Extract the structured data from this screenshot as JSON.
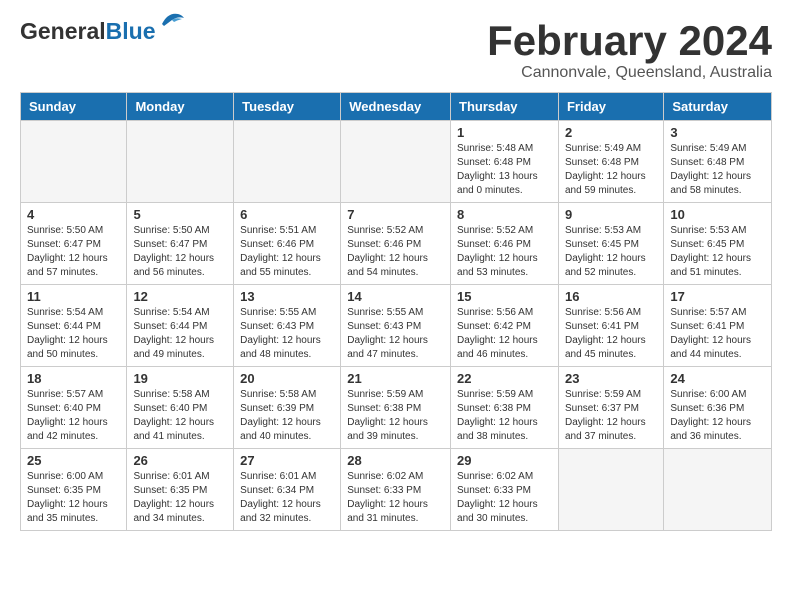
{
  "header": {
    "logo_general": "General",
    "logo_blue": "Blue",
    "title": "February 2024",
    "location": "Cannonvale, Queensland, Australia"
  },
  "days_of_week": [
    "Sunday",
    "Monday",
    "Tuesday",
    "Wednesday",
    "Thursday",
    "Friday",
    "Saturday"
  ],
  "weeks": [
    [
      {
        "day": "",
        "info": ""
      },
      {
        "day": "",
        "info": ""
      },
      {
        "day": "",
        "info": ""
      },
      {
        "day": "",
        "info": ""
      },
      {
        "day": "1",
        "info": "Sunrise: 5:48 AM\nSunset: 6:48 PM\nDaylight: 13 hours\nand 0 minutes."
      },
      {
        "day": "2",
        "info": "Sunrise: 5:49 AM\nSunset: 6:48 PM\nDaylight: 12 hours\nand 59 minutes."
      },
      {
        "day": "3",
        "info": "Sunrise: 5:49 AM\nSunset: 6:48 PM\nDaylight: 12 hours\nand 58 minutes."
      }
    ],
    [
      {
        "day": "4",
        "info": "Sunrise: 5:50 AM\nSunset: 6:47 PM\nDaylight: 12 hours\nand 57 minutes."
      },
      {
        "day": "5",
        "info": "Sunrise: 5:50 AM\nSunset: 6:47 PM\nDaylight: 12 hours\nand 56 minutes."
      },
      {
        "day": "6",
        "info": "Sunrise: 5:51 AM\nSunset: 6:46 PM\nDaylight: 12 hours\nand 55 minutes."
      },
      {
        "day": "7",
        "info": "Sunrise: 5:52 AM\nSunset: 6:46 PM\nDaylight: 12 hours\nand 54 minutes."
      },
      {
        "day": "8",
        "info": "Sunrise: 5:52 AM\nSunset: 6:46 PM\nDaylight: 12 hours\nand 53 minutes."
      },
      {
        "day": "9",
        "info": "Sunrise: 5:53 AM\nSunset: 6:45 PM\nDaylight: 12 hours\nand 52 minutes."
      },
      {
        "day": "10",
        "info": "Sunrise: 5:53 AM\nSunset: 6:45 PM\nDaylight: 12 hours\nand 51 minutes."
      }
    ],
    [
      {
        "day": "11",
        "info": "Sunrise: 5:54 AM\nSunset: 6:44 PM\nDaylight: 12 hours\nand 50 minutes."
      },
      {
        "day": "12",
        "info": "Sunrise: 5:54 AM\nSunset: 6:44 PM\nDaylight: 12 hours\nand 49 minutes."
      },
      {
        "day": "13",
        "info": "Sunrise: 5:55 AM\nSunset: 6:43 PM\nDaylight: 12 hours\nand 48 minutes."
      },
      {
        "day": "14",
        "info": "Sunrise: 5:55 AM\nSunset: 6:43 PM\nDaylight: 12 hours\nand 47 minutes."
      },
      {
        "day": "15",
        "info": "Sunrise: 5:56 AM\nSunset: 6:42 PM\nDaylight: 12 hours\nand 46 minutes."
      },
      {
        "day": "16",
        "info": "Sunrise: 5:56 AM\nSunset: 6:41 PM\nDaylight: 12 hours\nand 45 minutes."
      },
      {
        "day": "17",
        "info": "Sunrise: 5:57 AM\nSunset: 6:41 PM\nDaylight: 12 hours\nand 44 minutes."
      }
    ],
    [
      {
        "day": "18",
        "info": "Sunrise: 5:57 AM\nSunset: 6:40 PM\nDaylight: 12 hours\nand 42 minutes."
      },
      {
        "day": "19",
        "info": "Sunrise: 5:58 AM\nSunset: 6:40 PM\nDaylight: 12 hours\nand 41 minutes."
      },
      {
        "day": "20",
        "info": "Sunrise: 5:58 AM\nSunset: 6:39 PM\nDaylight: 12 hours\nand 40 minutes."
      },
      {
        "day": "21",
        "info": "Sunrise: 5:59 AM\nSunset: 6:38 PM\nDaylight: 12 hours\nand 39 minutes."
      },
      {
        "day": "22",
        "info": "Sunrise: 5:59 AM\nSunset: 6:38 PM\nDaylight: 12 hours\nand 38 minutes."
      },
      {
        "day": "23",
        "info": "Sunrise: 5:59 AM\nSunset: 6:37 PM\nDaylight: 12 hours\nand 37 minutes."
      },
      {
        "day": "24",
        "info": "Sunrise: 6:00 AM\nSunset: 6:36 PM\nDaylight: 12 hours\nand 36 minutes."
      }
    ],
    [
      {
        "day": "25",
        "info": "Sunrise: 6:00 AM\nSunset: 6:35 PM\nDaylight: 12 hours\nand 35 minutes."
      },
      {
        "day": "26",
        "info": "Sunrise: 6:01 AM\nSunset: 6:35 PM\nDaylight: 12 hours\nand 34 minutes."
      },
      {
        "day": "27",
        "info": "Sunrise: 6:01 AM\nSunset: 6:34 PM\nDaylight: 12 hours\nand 32 minutes."
      },
      {
        "day": "28",
        "info": "Sunrise: 6:02 AM\nSunset: 6:33 PM\nDaylight: 12 hours\nand 31 minutes."
      },
      {
        "day": "29",
        "info": "Sunrise: 6:02 AM\nSunset: 6:33 PM\nDaylight: 12 hours\nand 30 minutes."
      },
      {
        "day": "",
        "info": ""
      },
      {
        "day": "",
        "info": ""
      }
    ]
  ]
}
